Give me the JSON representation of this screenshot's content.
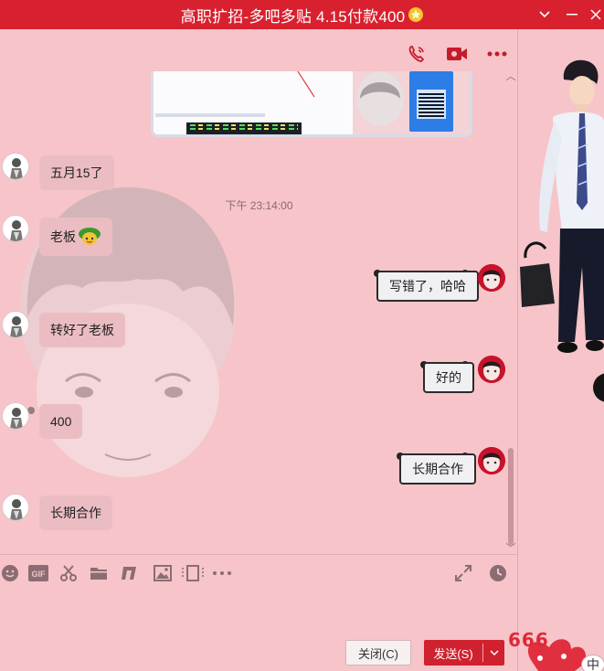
{
  "window": {
    "title": "高职扩招-多吧多贴 4.15付款400",
    "title_icon": "star-icon"
  },
  "header_icons": [
    "phone-call-icon",
    "video-call-icon",
    "more-icon"
  ],
  "chat": {
    "timestamp": "下午 23:14:00",
    "messages": [
      {
        "side": "left",
        "text": "五月15了"
      },
      {
        "side": "left",
        "text": "老板",
        "emoji": "money-bag-emoji"
      },
      {
        "side": "right",
        "text": "写错了，哈哈"
      },
      {
        "side": "left",
        "text": "转好了老板"
      },
      {
        "side": "right",
        "text": "好的"
      },
      {
        "side": "left",
        "text": "400"
      },
      {
        "side": "right",
        "text": "长期合作"
      },
      {
        "side": "left",
        "text": "长期合作"
      }
    ]
  },
  "toolbar": {
    "items": [
      "emoji-icon",
      "gif-icon",
      "scissors-icon",
      "folder-icon",
      "music-icon",
      "image-icon",
      "screen-record-icon",
      "more-icon",
      "expand-icon",
      "history-clock-icon"
    ],
    "gif_label": "GIF"
  },
  "buttons": {
    "close_label": "关闭(C)",
    "send_label": "发送(S)"
  },
  "right_panel": {
    "badge": "666",
    "ime_label": "中"
  },
  "colors": {
    "title_bar": "#d9202e",
    "chat_bg": "#f6c4c9",
    "send_button": "#d0212f"
  }
}
